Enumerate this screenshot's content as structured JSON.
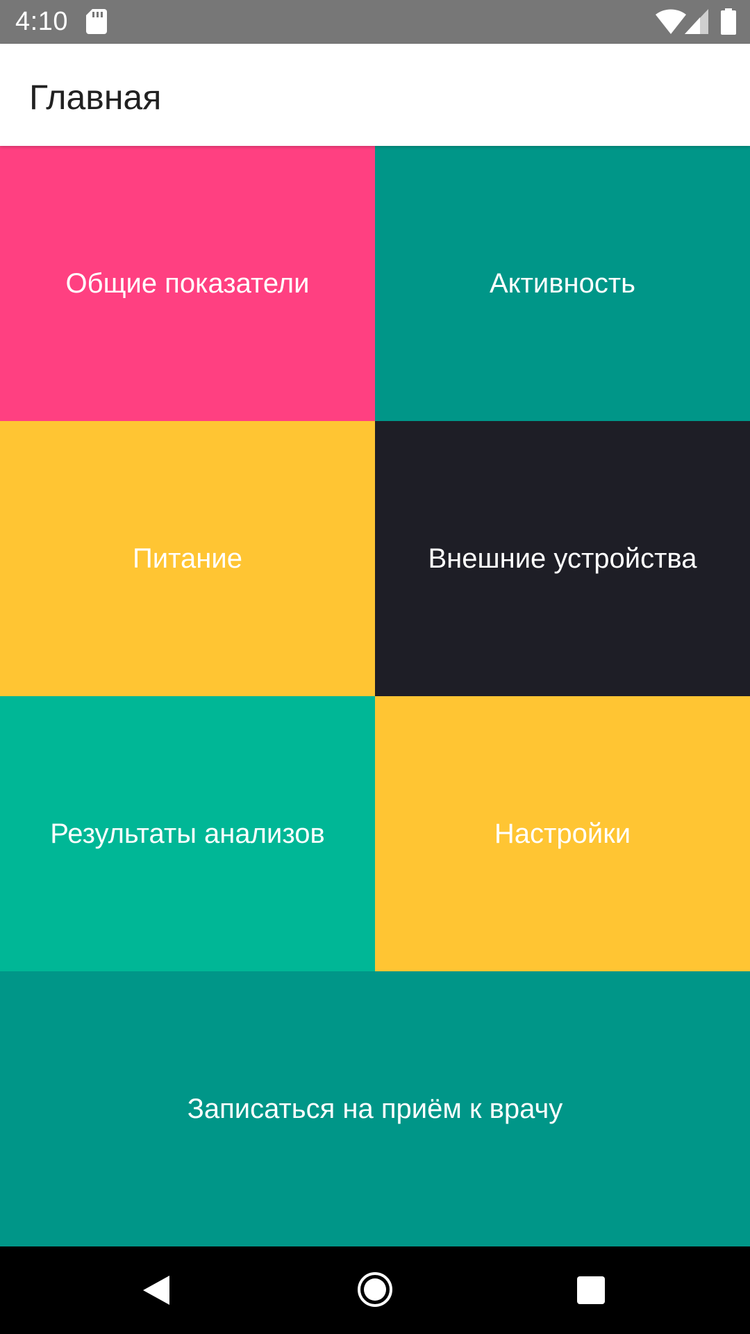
{
  "status_bar": {
    "time": "4:10",
    "icons": [
      "sd-card-icon",
      "wifi-icon",
      "signal-icon",
      "battery-icon"
    ]
  },
  "app_bar": {
    "title": "Главная"
  },
  "tiles": [
    {
      "label": "Общие показатели",
      "color": "#FF4081"
    },
    {
      "label": "Активность",
      "color": "#009688"
    },
    {
      "label": "Питание",
      "color": "#FFC533"
    },
    {
      "label": "Внешние устройства",
      "color": "#1E1E26"
    },
    {
      "label": "Результаты анализов",
      "color": "#00B796"
    },
    {
      "label": "Настройки",
      "color": "#FFC533"
    },
    {
      "label": "Записаться на приём к врачу",
      "color": "#009688"
    }
  ],
  "nav_bar": {
    "icons": [
      "back-icon",
      "home-icon",
      "recent-apps-icon"
    ]
  }
}
